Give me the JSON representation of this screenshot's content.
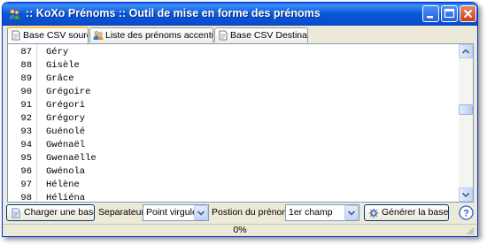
{
  "window": {
    "title": ":: KoXo Prénoms :: Outil de mise en forme des prénoms"
  },
  "tabs": [
    {
      "label": "Base CSV source",
      "icon": "document-icon",
      "active": true
    },
    {
      "label": "Liste des prénoms accentués",
      "icon": "users-icon",
      "active": false
    },
    {
      "label": "Base CSV Destination",
      "icon": "document-icon",
      "active": false
    }
  ],
  "rows": [
    {
      "num": "87",
      "name": "Géry"
    },
    {
      "num": "88",
      "name": "Gisèle"
    },
    {
      "num": "89",
      "name": "Grâce"
    },
    {
      "num": "90",
      "name": "Grégoire"
    },
    {
      "num": "91",
      "name": "Grégori"
    },
    {
      "num": "92",
      "name": "Grégory"
    },
    {
      "num": "93",
      "name": "Guénolé"
    },
    {
      "num": "94",
      "name": "Gwénaël"
    },
    {
      "num": "95",
      "name": "Gwenaëlle"
    },
    {
      "num": "96",
      "name": "Gwénola"
    },
    {
      "num": "97",
      "name": "Hélène"
    },
    {
      "num": "98",
      "name": "Héliéna"
    }
  ],
  "toolbar": {
    "load_label": "Charger une base",
    "separator_label": "Separateur",
    "separator_value": "Point virgule",
    "position_label": "Postion du prénom",
    "position_value": "1er champ",
    "generate_label": "Générer la base"
  },
  "status": {
    "progress_text": "0%"
  },
  "colors": {
    "titlebar": "#0a57d6",
    "tab_highlight": "#ffc83c",
    "face": "#ece9d8"
  }
}
